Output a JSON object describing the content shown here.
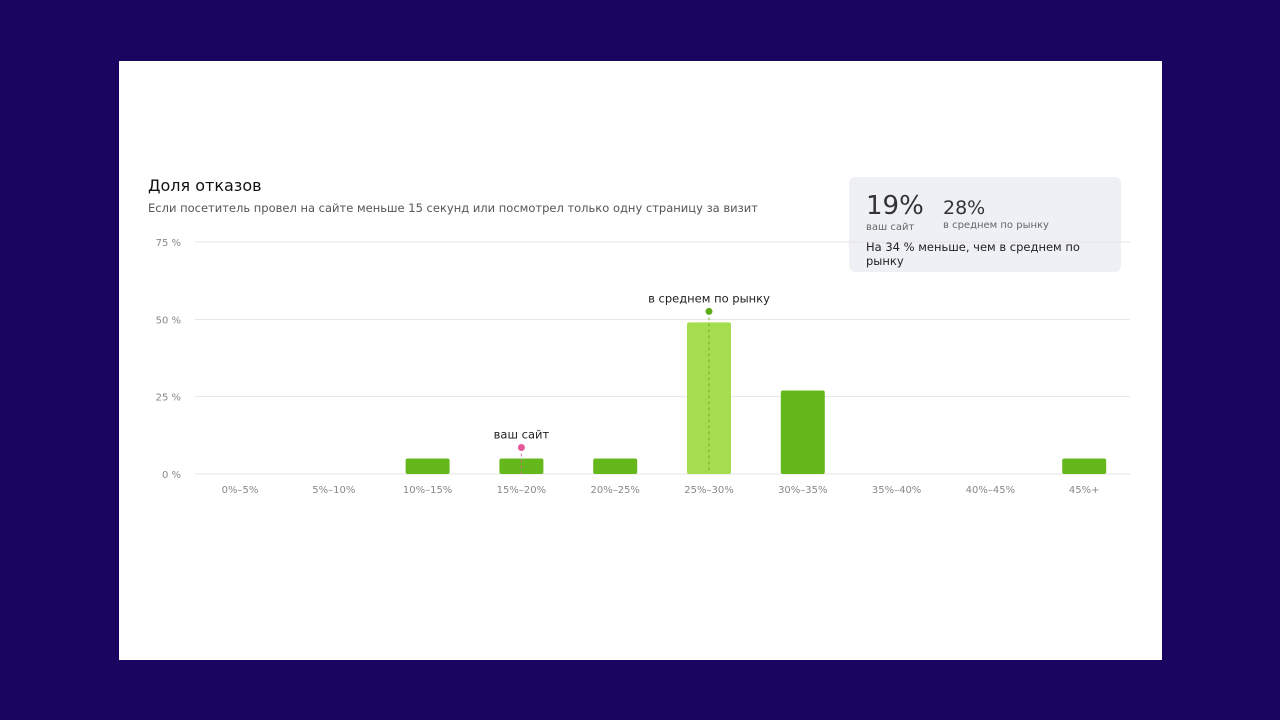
{
  "chart_data": {
    "type": "bar",
    "title": "Доля отказов",
    "subtitle": "Если посетитель провел на сайте меньше 15 секунд или посмотрел только одну страницу за визит",
    "categories": [
      "0%–5%",
      "5%–10%",
      "10%–15%",
      "15%–20%",
      "20%–25%",
      "25%–30%",
      "30%–35%",
      "35%–40%",
      "40%–45%",
      "45%+"
    ],
    "values": [
      0,
      0,
      5,
      5,
      5,
      49,
      27,
      0,
      0,
      5
    ],
    "y_ticks": [
      0,
      25,
      50,
      75
    ],
    "y_tick_labels": [
      "0 %",
      "25 %",
      "50 %",
      "75 %"
    ],
    "ylim": [
      0,
      75
    ],
    "grid": true,
    "highlight_category": "25%–30%",
    "colors": {
      "bar": "#64b81c",
      "highlight": "#a6dd4e",
      "site_marker": "#e5589a",
      "market_marker": "#5dab18",
      "grid": "#e5e5e5"
    },
    "annotations": [
      {
        "text": "ваш сайт",
        "category": "15%–20%",
        "at_value": 5,
        "color": "#e5589a"
      },
      {
        "text": "в среднем по рынку",
        "category": "25%–30%",
        "at_value": 49,
        "color": "#5dab18"
      }
    ]
  },
  "summary": {
    "site_value": "19%",
    "site_label": "ваш сайт",
    "market_value": "28%",
    "market_label": "в среднем по рынку",
    "comparison": "На 34 % меньше, чем в среднем по рынку"
  }
}
